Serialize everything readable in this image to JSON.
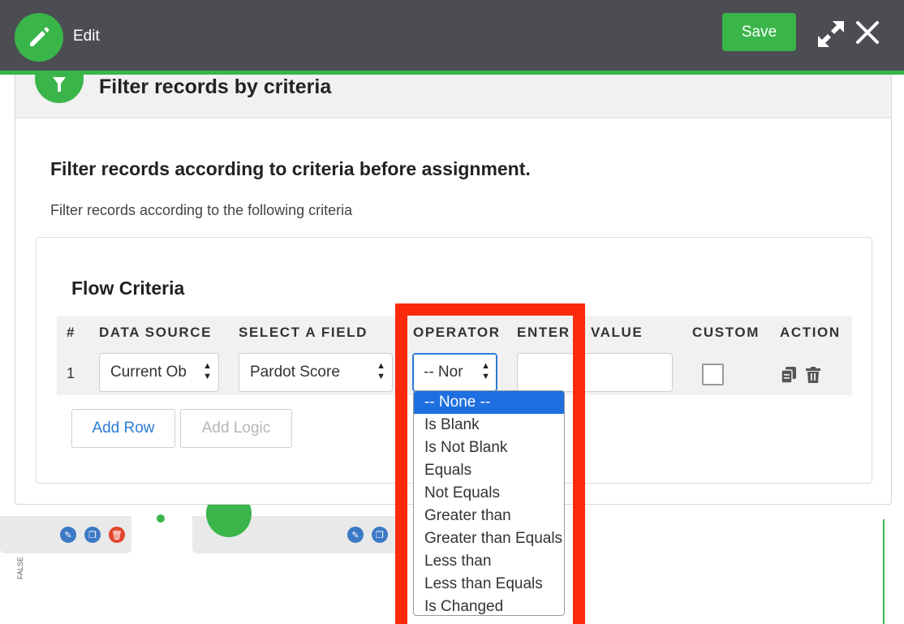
{
  "header": {
    "title": "Edit",
    "save_label": "Save"
  },
  "section": {
    "title": "Filter records by criteria"
  },
  "criteria": {
    "heading": "Filter records according to criteria before assignment.",
    "description": "Filter records according to the following criteria"
  },
  "flow": {
    "title": "Flow Criteria",
    "columns": [
      "#",
      "DATA SOURCE",
      "SELECT A FIELD",
      "OPERATOR",
      "ENTER",
      "VALUE",
      "CUSTOM",
      "ACTION"
    ],
    "rows": [
      {
        "num": "1",
        "data_source": "Current Ob",
        "field": "Pardot Score",
        "operator": "-- Nor",
        "value": "",
        "custom": false
      }
    ],
    "add_row_label": "Add Row",
    "add_logic_label": "Add Logic"
  },
  "operator_dropdown": {
    "options": [
      "-- None --",
      "Is Blank",
      "Is Not Blank",
      "Equals",
      "Not Equals",
      "Greater than",
      "Greater than Equals",
      "Less than",
      "Less than Equals",
      "Is Changed"
    ],
    "selected": "-- None --"
  },
  "background": {
    "vertical_label": "FALSE"
  },
  "colors": {
    "accent_green": "#3ab54a",
    "topbar": "#4b4d52",
    "link_blue": "#2a7bd5",
    "highlight_red": "#fb2a0c",
    "selected_option": "#1e6fe0"
  }
}
